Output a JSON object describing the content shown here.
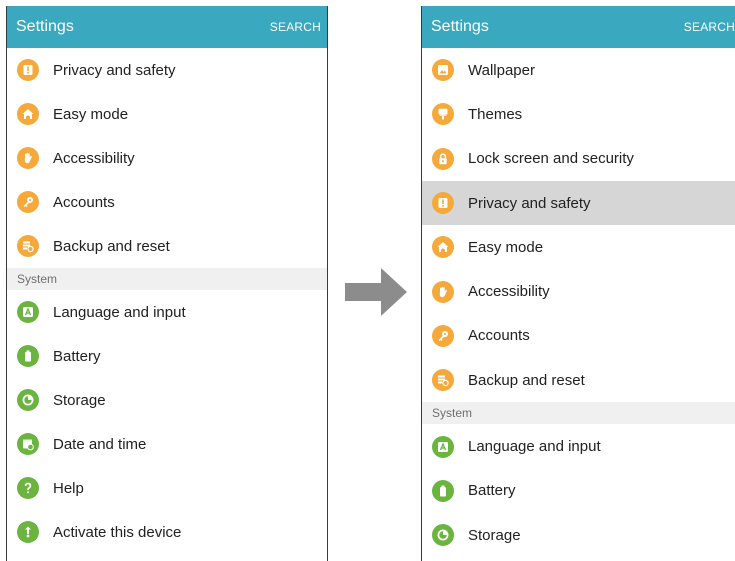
{
  "left": {
    "header": {
      "title": "Settings",
      "search": "SEARCH"
    },
    "items": [
      {
        "label": "Privacy and safety"
      },
      {
        "label": "Easy mode"
      },
      {
        "label": "Accessibility"
      },
      {
        "label": "Accounts"
      },
      {
        "label": "Backup and reset"
      }
    ],
    "section": "System",
    "system_items": [
      {
        "label": "Language and input"
      },
      {
        "label": "Battery"
      },
      {
        "label": "Storage"
      },
      {
        "label": "Date and time"
      },
      {
        "label": "Help"
      },
      {
        "label": "Activate this device"
      }
    ]
  },
  "right": {
    "header": {
      "title": "Settings",
      "search": "SEARCH"
    },
    "items": [
      {
        "label": "Wallpaper"
      },
      {
        "label": "Themes"
      },
      {
        "label": "Lock screen and security"
      },
      {
        "label": "Privacy and safety",
        "selected": true
      },
      {
        "label": "Easy mode"
      },
      {
        "label": "Accessibility"
      },
      {
        "label": "Accounts"
      },
      {
        "label": "Backup and reset"
      }
    ],
    "section": "System",
    "system_items": [
      {
        "label": "Language and input"
      },
      {
        "label": "Battery"
      },
      {
        "label": "Storage"
      }
    ]
  },
  "icons": {
    "privacy": "privacy-icon",
    "easy_mode": "easy-mode-icon",
    "accessibility": "accessibility-icon",
    "accounts": "accounts-icon",
    "backup": "backup-icon",
    "language": "language-icon",
    "battery": "battery-icon",
    "storage": "storage-icon",
    "date_time": "date-time-icon",
    "help": "help-icon",
    "activate": "activate-icon",
    "wallpaper": "wallpaper-icon",
    "themes": "themes-icon",
    "lock": "lock-icon"
  },
  "colors": {
    "header": "#3aa8be",
    "orange_icon": "#f4a93a",
    "green_icon": "#6bb43f",
    "selected_row": "#d6d6d6",
    "arrow": "#8c8c8c"
  }
}
